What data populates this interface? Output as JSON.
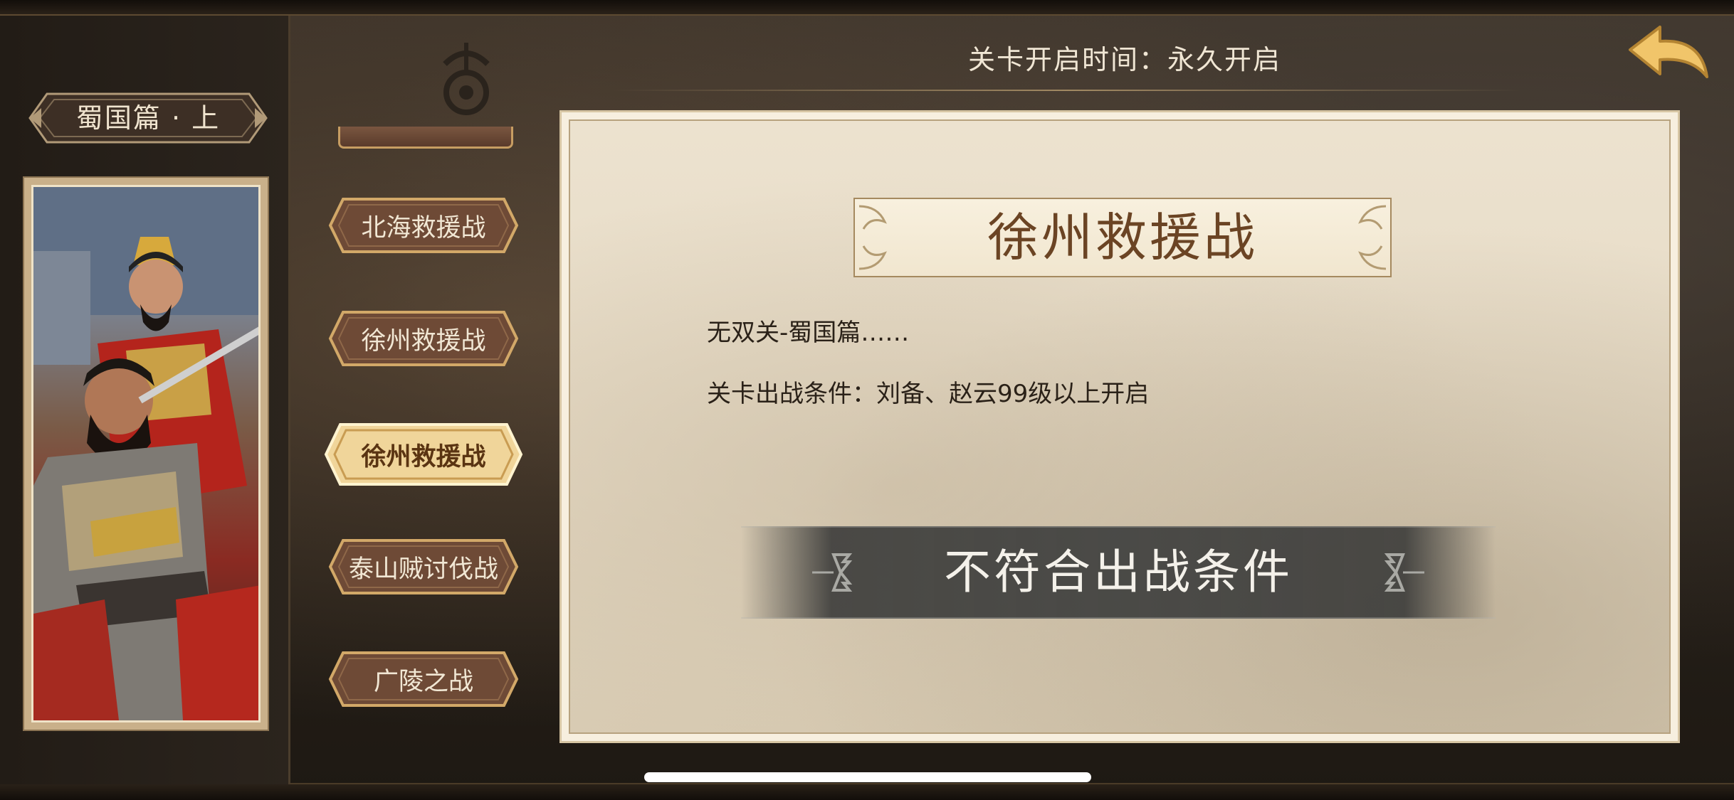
{
  "header": {
    "open_time": "关卡开启时间：永久开启"
  },
  "sidebar": {
    "chapter_title": "蜀国篇 · 上"
  },
  "stages": [
    {
      "label": "北海救援战",
      "active": false
    },
    {
      "label": "徐州救援战",
      "active": false
    },
    {
      "label": "徐州救援战",
      "active": true
    },
    {
      "label": "泰山贼讨伐战",
      "active": false
    },
    {
      "label": "广陵之战",
      "active": false
    }
  ],
  "detail": {
    "title": "徐州救援战",
    "description": "无双关-蜀国篇……",
    "condition": "关卡出战条件：刘备、赵云99级以上开启",
    "status": "不符合出战条件"
  },
  "colors": {
    "accent_gold": "#e5b96a",
    "stage_button_bg": "#6e4a36",
    "active_button_bg": "#f0d59a",
    "card_bg": "#ece2cf",
    "status_bar": "#444442"
  },
  "icons": {
    "back": "back-arrow-icon"
  }
}
